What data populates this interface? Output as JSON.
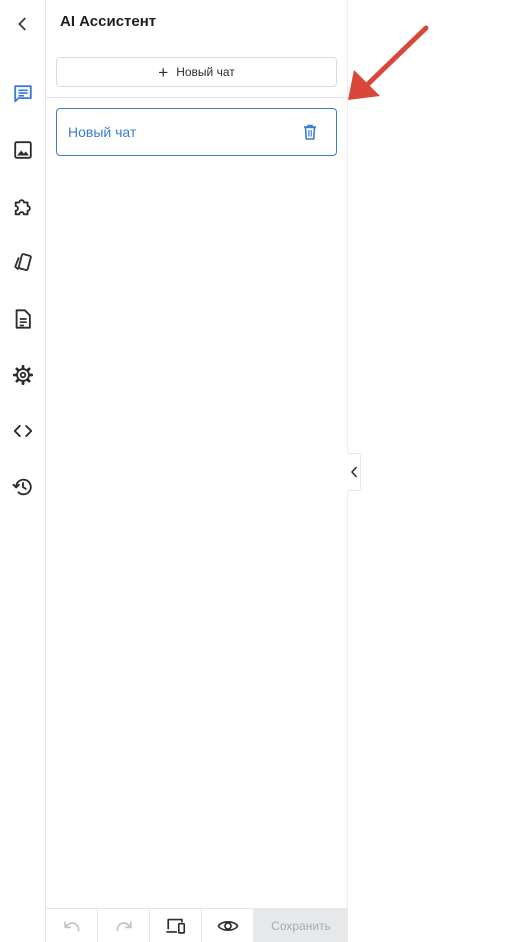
{
  "panel": {
    "title": "AI Ассистент",
    "new_chat_label": "Новый чат"
  },
  "chats": [
    {
      "name": "Новый чат",
      "active": true
    }
  ],
  "rail_icons": [
    "chevron-left-icon",
    "chat-icon",
    "image-icon",
    "puzzle-icon",
    "cards-icon",
    "document-icon",
    "gear-icon",
    "code-icon",
    "history-icon"
  ],
  "toolbar": {
    "save_label": "Сохранить"
  },
  "colors": {
    "accent": "#3a7bd5",
    "annotation_arrow": "#d9473a",
    "save_bg": "#e6e8ea",
    "save_text": "#a7abaf"
  }
}
